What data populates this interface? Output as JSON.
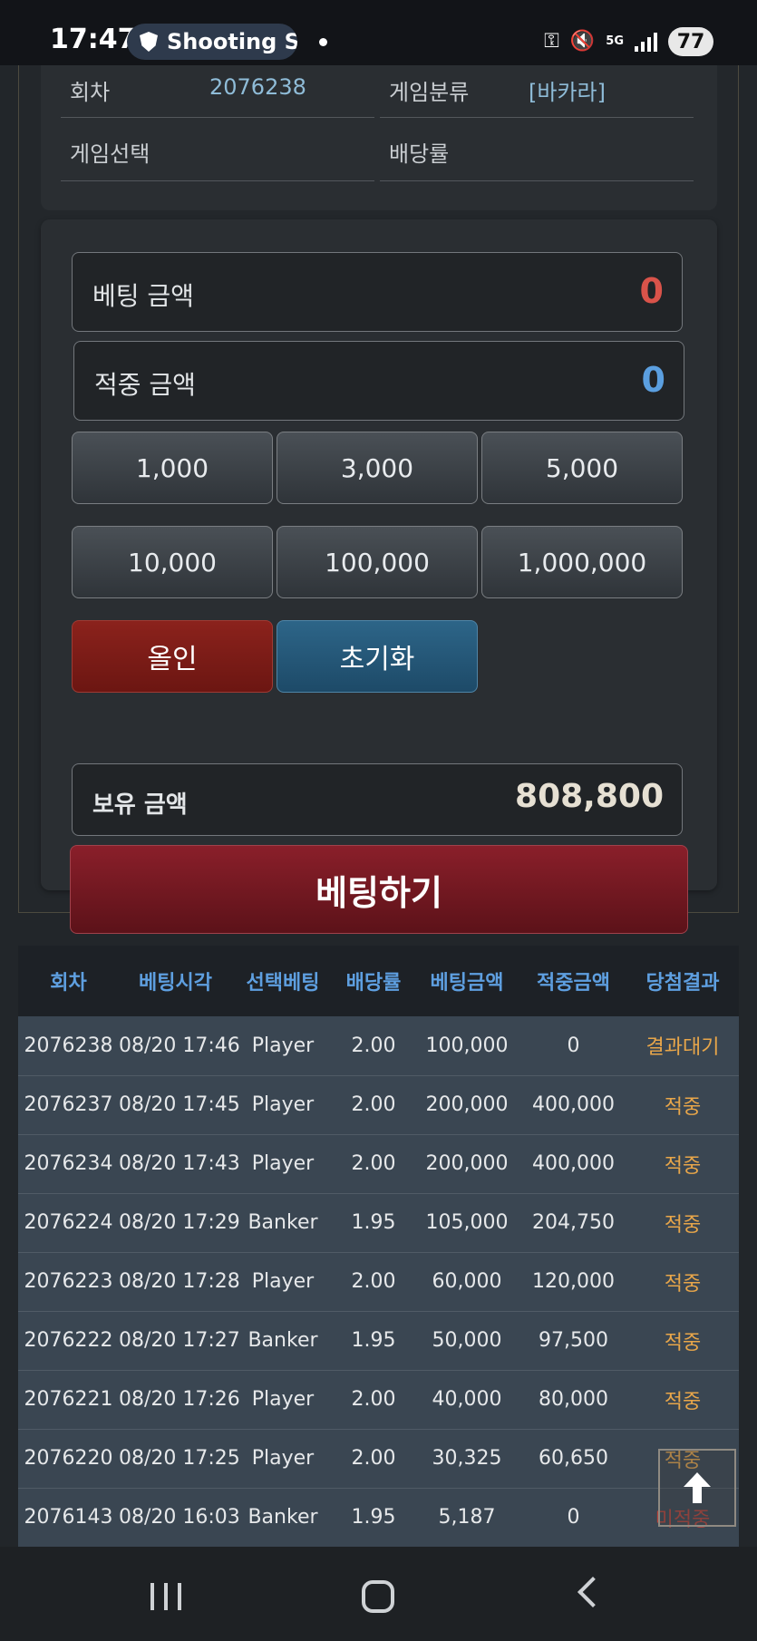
{
  "status_bar": {
    "time": "17:47",
    "tab_title": "Shooting S",
    "network": "5G",
    "battery": "77"
  },
  "info": {
    "round_label": "회차",
    "round_value": "2076238",
    "category_label": "게임분류",
    "category_value": "[바카라]",
    "selection_label": "게임선택",
    "odds_label": "배당률"
  },
  "betting": {
    "bet_amount_label": "베팅 금액",
    "bet_amount_value": "0",
    "win_amount_label": "적중 금액",
    "win_amount_value": "0",
    "chips": [
      "1,000",
      "3,000",
      "5,000",
      "10,000",
      "100,000",
      "1,000,000"
    ],
    "allin_label": "올인",
    "reset_label": "초기화",
    "balance_label": "보유 금액",
    "balance_value": "808,800",
    "submit_label": "베팅하기"
  },
  "history": {
    "headers": [
      "회차",
      "베팅시각",
      "선택베팅",
      "배당률",
      "베팅금액",
      "적중금액",
      "당첨결과"
    ],
    "rows": [
      [
        "2076238",
        "08/20 17:46",
        "Player",
        "2.00",
        "100,000",
        "0",
        "결과대기"
      ],
      [
        "2076237",
        "08/20 17:45",
        "Player",
        "2.00",
        "200,000",
        "400,000",
        "적중"
      ],
      [
        "2076234",
        "08/20 17:43",
        "Player",
        "2.00",
        "200,000",
        "400,000",
        "적중"
      ],
      [
        "2076224",
        "08/20 17:29",
        "Banker",
        "1.95",
        "105,000",
        "204,750",
        "적중"
      ],
      [
        "2076223",
        "08/20 17:28",
        "Player",
        "2.00",
        "60,000",
        "120,000",
        "적중"
      ],
      [
        "2076222",
        "08/20 17:27",
        "Banker",
        "1.95",
        "50,000",
        "97,500",
        "적중"
      ],
      [
        "2076221",
        "08/20 17:26",
        "Player",
        "2.00",
        "40,000",
        "80,000",
        "적중"
      ],
      [
        "2076220",
        "08/20 17:25",
        "Player",
        "2.00",
        "30,325",
        "60,650",
        "적중"
      ],
      [
        "2076143",
        "08/20 16:03",
        "Banker",
        "1.95",
        "5,187",
        "0",
        "미적중"
      ]
    ]
  },
  "colors": {
    "bet_amount": "#d9534a",
    "win_amount": "#5b9fe0",
    "result_text": "#e8a64a",
    "result_lost": "#b8433a"
  },
  "icons": {
    "scroll_top": "arrow-up-icon"
  }
}
